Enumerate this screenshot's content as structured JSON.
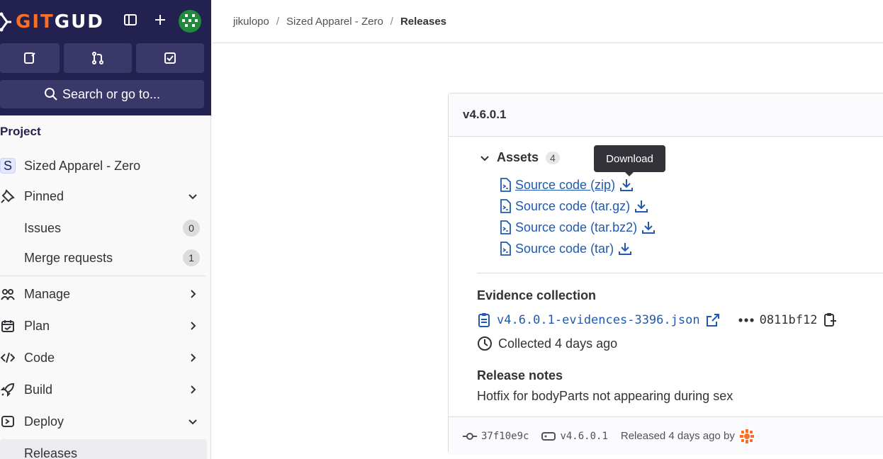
{
  "brand": {
    "git": "GIT",
    "gud": "GUD"
  },
  "sidebar": {
    "search_label": "Search or go to...",
    "section_title": "Project",
    "project": {
      "initial": "S",
      "name": "Sized Apparel - Zero"
    },
    "items": [
      {
        "label": "Pinned",
        "icon": "pin-icon"
      },
      {
        "label": "Issues",
        "count": "0"
      },
      {
        "label": "Merge requests",
        "count": "1"
      },
      {
        "label": "Manage",
        "icon": "users-icon"
      },
      {
        "label": "Plan",
        "icon": "calendar-icon"
      },
      {
        "label": "Code",
        "icon": "code-icon"
      },
      {
        "label": "Build",
        "icon": "rocket-icon"
      },
      {
        "label": "Deploy",
        "icon": "deploy-icon"
      },
      {
        "label": "Releases"
      }
    ]
  },
  "breadcrumb": {
    "items": [
      "jikulopo",
      "Sized Apparel - Zero",
      "Releases"
    ],
    "separator": "/"
  },
  "release": {
    "tag": "v4.6.0.1",
    "assets_label": "Assets",
    "assets_count": "4",
    "assets": [
      {
        "name": "Source code (zip)"
      },
      {
        "name": "Source code (tar.gz)"
      },
      {
        "name": "Source code (tar.bz2)"
      },
      {
        "name": "Source code (tar)"
      }
    ],
    "tooltip": "Download",
    "evidence_title": "Evidence collection",
    "evidence_file": "v4.6.0.1-evidences-3396.json",
    "evidence_hash": "0811bf12",
    "collected": "Collected 4 days ago",
    "notes_title": "Release notes",
    "notes": "Hotfix for bodyParts not appearing during sex",
    "footer": {
      "commit": "37f10e9c",
      "tag": "v4.6.0.1",
      "released": "Released 4 days ago by"
    }
  },
  "colors": {
    "sidebar_dark": "#232150",
    "link": "#1f5ab0",
    "brand_orange": "#fc6d26"
  }
}
